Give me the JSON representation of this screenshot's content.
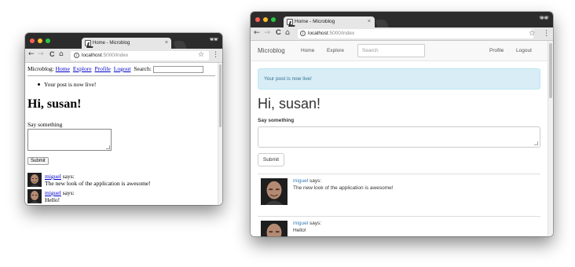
{
  "windows": {
    "plain": {
      "tab_title": "Home - Microblog",
      "url_host": "localhost",
      "url_path": ":5000/index",
      "nav": {
        "brand": "Microblog:",
        "home": "Home",
        "explore": "Explore",
        "profile": "Profile",
        "logout": "Logout",
        "search_label": "Search:"
      },
      "flash": "Your post is now live!",
      "heading": "Hi, susan!",
      "form": {
        "label": "Say something",
        "submit": "Submit"
      },
      "posts": [
        {
          "author": "miguel",
          "says": " says:",
          "body": "The new look of the application is awesome!"
        },
        {
          "author": "miguel",
          "says": " says:",
          "body": "Hello!"
        }
      ]
    },
    "bootstrap": {
      "tab_title": "Home - Microblog",
      "url_host": "localhost",
      "url_path": ":5000/index",
      "nav": {
        "brand": "Microblog",
        "home": "Home",
        "explore": "Explore",
        "search_placeholder": "Search",
        "profile": "Profile",
        "logout": "Logout"
      },
      "flash": "Your post is now live!",
      "heading": "Hi, susan!",
      "form": {
        "label": "Say something",
        "submit": "Submit"
      },
      "posts": [
        {
          "author": "miguel",
          "says": " says:",
          "body": "The new look of the application is awesome!"
        },
        {
          "author": "miguel",
          "says": " says:",
          "body": "Hello!"
        }
      ]
    }
  },
  "icons": {
    "close": "×",
    "incognito": "incognito-icon",
    "back": "←",
    "forward": "→",
    "reload": "C",
    "home": "⌂",
    "star": "☆",
    "menu": "⋮",
    "info": "i"
  },
  "colors": {
    "titlebar": "#2c2c2c",
    "traffic_close": "#ff5f57",
    "traffic_min": "#ffbd2e",
    "traffic_max": "#28c840",
    "alert_bg": "#d9edf7",
    "alert_text": "#31708f",
    "link_plain": "#0000cc",
    "link_bootstrap": "#337ab7"
  }
}
